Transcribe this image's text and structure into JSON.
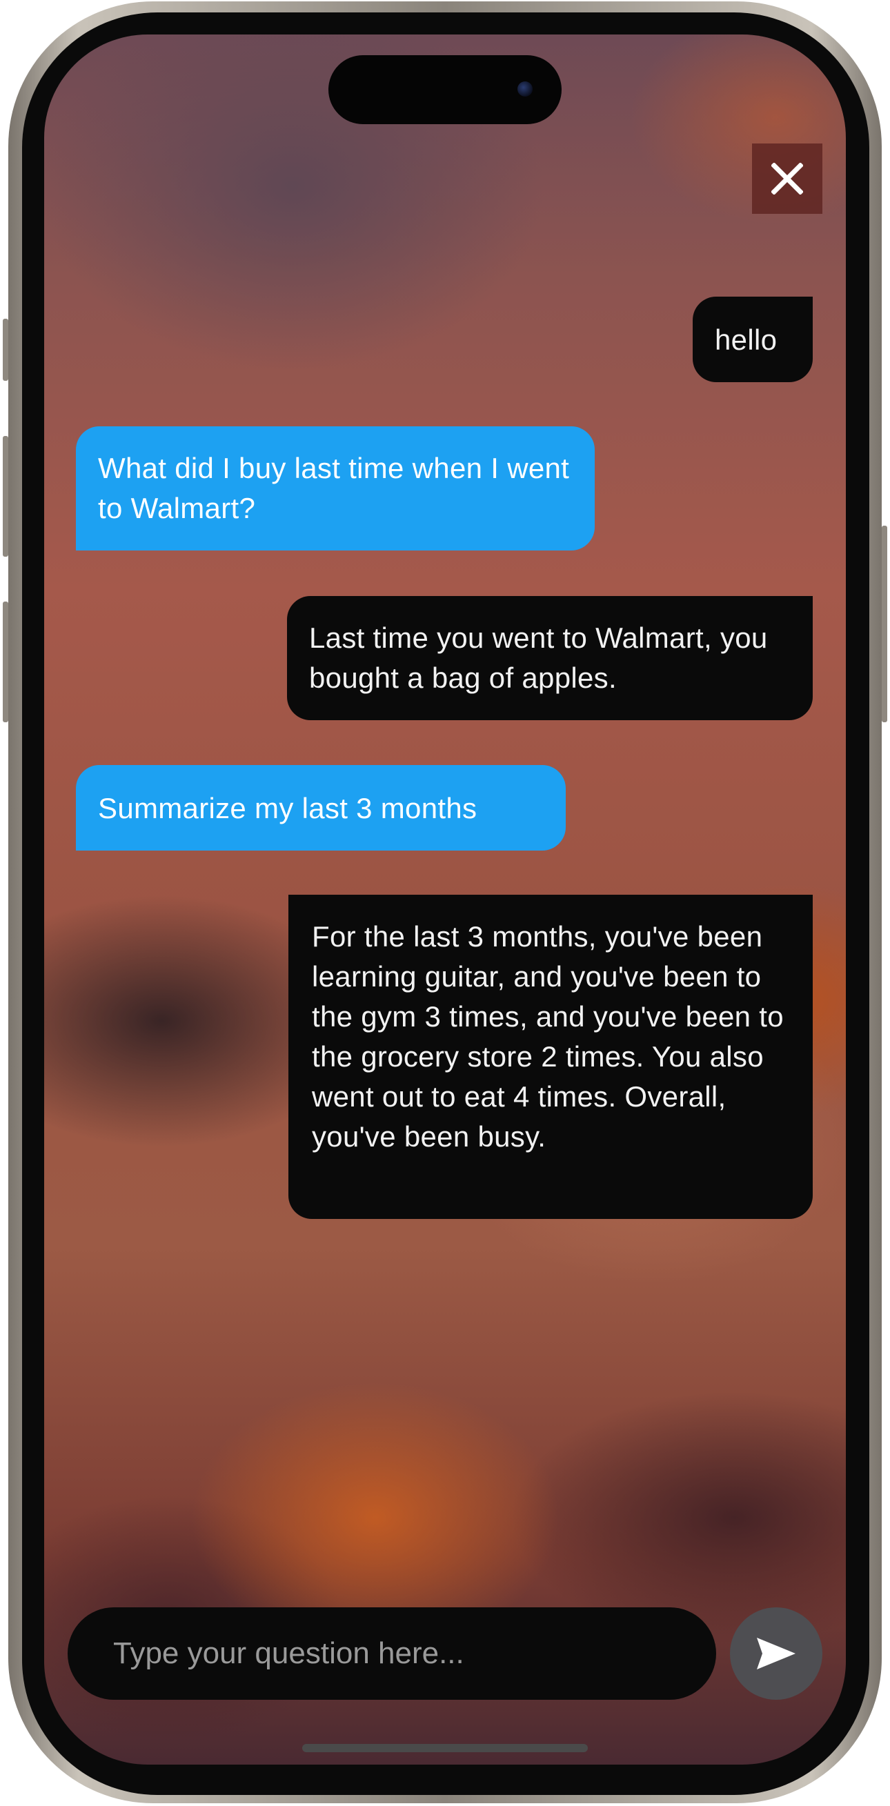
{
  "chat": {
    "messages": [
      {
        "role": "bot",
        "text": "hello"
      },
      {
        "role": "user",
        "text": "What did I buy last time when I went to Walmart?"
      },
      {
        "role": "bot",
        "text": "Last time you went to Walmart, you bought a bag of apples."
      },
      {
        "role": "user",
        "text": "Summarize my last 3 months"
      },
      {
        "role": "bot",
        "text": "For the last 3 months, you've been learning guitar, and you've been to the gym 3 times, and you've been to the grocery store 2 times. You also went out to eat 4 times. Overall, you've been busy."
      }
    ]
  },
  "input": {
    "placeholder": "Type your question here...",
    "value": ""
  },
  "icons": {
    "close": "close-icon",
    "send": "send-icon",
    "camera": "camera-icon"
  },
  "colors": {
    "user_bubble": "#1da1f2",
    "bot_bubble": "#0a0a0a",
    "send_button": "#4e4e52",
    "close_button": "#5f2622"
  }
}
